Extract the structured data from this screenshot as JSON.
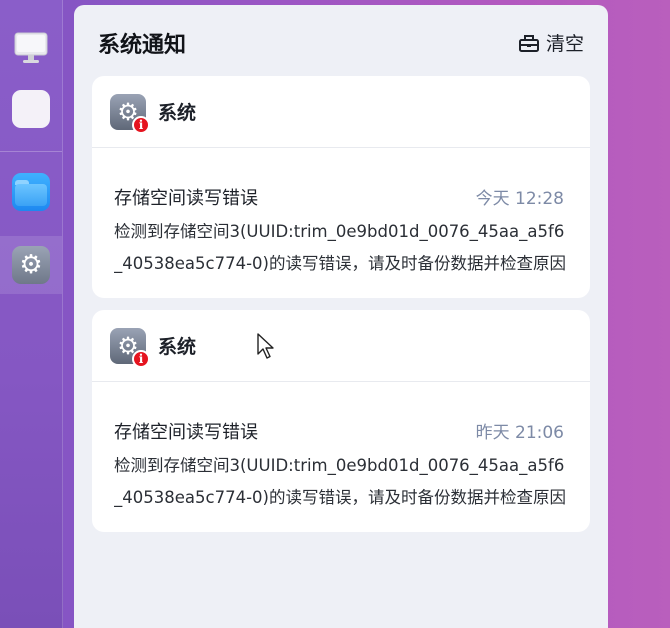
{
  "dock": {
    "items": [
      {
        "name": "monitor",
        "icon": "monitor-icon"
      },
      {
        "name": "apps",
        "icon": "app-grid-icon"
      },
      {
        "name": "files",
        "icon": "folder-icon"
      },
      {
        "name": "settings",
        "icon": "gear-icon",
        "active": true
      }
    ]
  },
  "panel": {
    "title": "系统通知",
    "clear_label": "清空",
    "clear_icon": "clear-icon"
  },
  "notifications": [
    {
      "app_name": "系统",
      "app_icon": "settings-gear-icon",
      "badge_icon": "info-badge-icon",
      "title": "存储空间读写错误",
      "time": "今天 12:28",
      "message": "检测到存储空间3(UUID:trim_0e9bd01d_0076_45aa_a5f6_40538ea5c774-0)的读写错误，请及时备份数据并检查原因"
    },
    {
      "app_name": "系统",
      "app_icon": "settings-gear-icon",
      "badge_icon": "info-badge-icon",
      "title": "存储空间读写错误",
      "time": "昨天 21:06",
      "message": "检测到存储空间3(UUID:trim_0e9bd01d_0076_45aa_a5f6_40538ea5c774-0)的读写错误，请及时备份数据并检查原因"
    }
  ],
  "colors": {
    "badge": "#e5141f",
    "time_text": "#7d8aa6",
    "panel_bg": "#eef0f6"
  }
}
